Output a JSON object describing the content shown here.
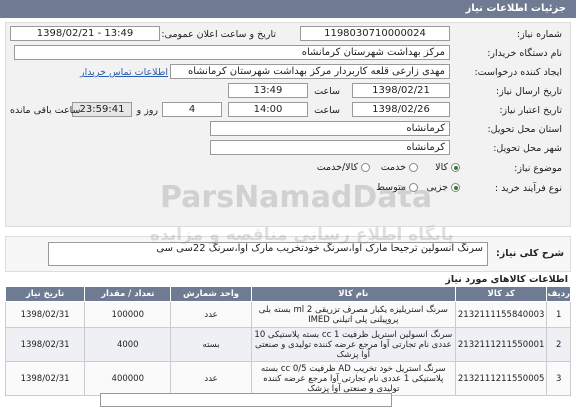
{
  "header": {
    "title": "جزئیات اطلاعات نیاز"
  },
  "form": {
    "need_number_label": "شماره نیاز:",
    "need_number": "1198030710000024",
    "announce_label": "تاریخ و ساعت اعلان عمومی:",
    "announce_value": "1398/02/21 - 13:49",
    "buyer_label": "نام دستگاه خریدار:",
    "buyer_value": "مرکز بهداشت شهرستان کرمانشاه",
    "creator_label": "ایجاد کننده درخواست:",
    "creator_value": "مهدی  زارعی قلعه کاربردار مرکز بهداشت شهرستان کرمانشاه",
    "contact_link": "اطلاعات تماس خریدار",
    "send_date_label": "تاریخ ارسال نیاز:",
    "send_date": "1398/02/21",
    "send_time_label": "ساعت",
    "send_time": "13:49",
    "validity_label": "تاریخ اعتبار نیاز:",
    "validity_date": "1398/02/26",
    "validity_time_label": "ساعت",
    "validity_time": "14:00",
    "days_value": "4",
    "days_label": "روز و",
    "remaining_value": "23:59:41",
    "remaining_label": "ساعت باقی مانده",
    "province_label": "استان محل تحویل:",
    "province_value": "کرمانشاه",
    "city_label": "شهر محل تحویل:",
    "city_value": "کرمانشاه",
    "category_label": "موضوع نیاز:",
    "category_options": [
      "کالا",
      "خدمت",
      "کالا/خدمت"
    ],
    "category_selected": "کالا",
    "process_label": "نوع فرآیند خرید :",
    "process_options": [
      "جزیی",
      "متوسط"
    ],
    "process_selected": "جزیی"
  },
  "description": {
    "label": "شرح کلی نیاز:",
    "value": "سرنگ انسولین ترجیحا مارک آوا،سرنگ خودتخریب مارک آوا،سرنگ 22سی سی"
  },
  "goods": {
    "title": "اطلاعات کالاهای مورد نیاز",
    "columns": [
      "ردیف",
      "کد کالا",
      "نام کالا",
      "واحد شمارش",
      "تعداد / مقدار",
      "تاریخ نیاز"
    ],
    "rows": [
      {
        "idx": "1",
        "code": "2132111155840003",
        "name": "سرنگ استریلیزه یکبار مصرف تزریقی ml 2 بسته بلی پروپیلنی پلی اتیلنی IMED",
        "unit": "عدد",
        "qty": "100000",
        "date": "1398/02/31"
      },
      {
        "idx": "2",
        "code": "2132111211550001",
        "name": "سرنگ انسولین استریل ظرفیت cc 1 بسته پلاستیکی 10 عددی نام تجارتی آوا مرجع عرضه کننده تولیدی و صنعتی آوا پزشک",
        "unit": "بسته",
        "qty": "4000",
        "date": "1398/02/31"
      },
      {
        "idx": "3",
        "code": "2132111211550005",
        "name": "سرنگ استریل خود تخریب AD ظرفیت cc 0/5 بسته پلاستیکی 1 عددی نام تجارتی آوا مرجع عرضه کننده تولیدی و صنعتی آوا پزشک",
        "unit": "عدد",
        "qty": "400000",
        "date": "1398/02/31"
      }
    ]
  },
  "watermark": {
    "brand": "ParsNamadData",
    "line": "پایگاه اطلاع رسانی مناقصه و مزایده"
  },
  "colors": {
    "header_bg": "#6f7b92",
    "link": "#2a5db0",
    "radio_selected": "#2e7d32"
  }
}
